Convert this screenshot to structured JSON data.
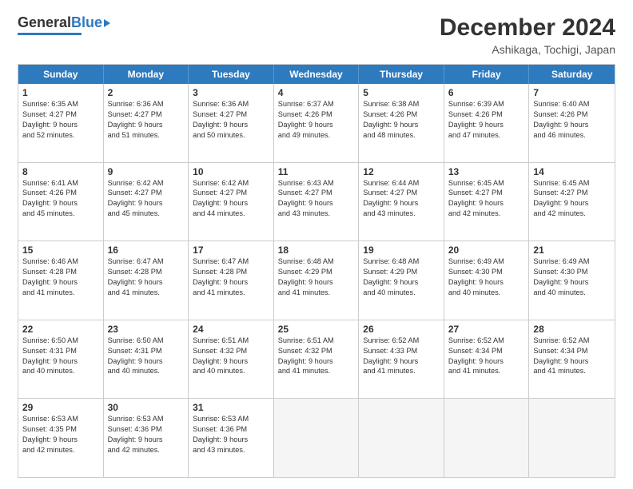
{
  "header": {
    "logo_general": "General",
    "logo_blue": "Blue",
    "month_year": "December 2024",
    "location": "Ashikaga, Tochigi, Japan"
  },
  "calendar": {
    "days_of_week": [
      "Sunday",
      "Monday",
      "Tuesday",
      "Wednesday",
      "Thursday",
      "Friday",
      "Saturday"
    ],
    "weeks": [
      [
        {
          "day": "1",
          "info": "Sunrise: 6:35 AM\nSunset: 4:27 PM\nDaylight: 9 hours\nand 52 minutes."
        },
        {
          "day": "2",
          "info": "Sunrise: 6:36 AM\nSunset: 4:27 PM\nDaylight: 9 hours\nand 51 minutes."
        },
        {
          "day": "3",
          "info": "Sunrise: 6:36 AM\nSunset: 4:27 PM\nDaylight: 9 hours\nand 50 minutes."
        },
        {
          "day": "4",
          "info": "Sunrise: 6:37 AM\nSunset: 4:26 PM\nDaylight: 9 hours\nand 49 minutes."
        },
        {
          "day": "5",
          "info": "Sunrise: 6:38 AM\nSunset: 4:26 PM\nDaylight: 9 hours\nand 48 minutes."
        },
        {
          "day": "6",
          "info": "Sunrise: 6:39 AM\nSunset: 4:26 PM\nDaylight: 9 hours\nand 47 minutes."
        },
        {
          "day": "7",
          "info": "Sunrise: 6:40 AM\nSunset: 4:26 PM\nDaylight: 9 hours\nand 46 minutes."
        }
      ],
      [
        {
          "day": "8",
          "info": "Sunrise: 6:41 AM\nSunset: 4:26 PM\nDaylight: 9 hours\nand 45 minutes."
        },
        {
          "day": "9",
          "info": "Sunrise: 6:42 AM\nSunset: 4:27 PM\nDaylight: 9 hours\nand 45 minutes."
        },
        {
          "day": "10",
          "info": "Sunrise: 6:42 AM\nSunset: 4:27 PM\nDaylight: 9 hours\nand 44 minutes."
        },
        {
          "day": "11",
          "info": "Sunrise: 6:43 AM\nSunset: 4:27 PM\nDaylight: 9 hours\nand 43 minutes."
        },
        {
          "day": "12",
          "info": "Sunrise: 6:44 AM\nSunset: 4:27 PM\nDaylight: 9 hours\nand 43 minutes."
        },
        {
          "day": "13",
          "info": "Sunrise: 6:45 AM\nSunset: 4:27 PM\nDaylight: 9 hours\nand 42 minutes."
        },
        {
          "day": "14",
          "info": "Sunrise: 6:45 AM\nSunset: 4:27 PM\nDaylight: 9 hours\nand 42 minutes."
        }
      ],
      [
        {
          "day": "15",
          "info": "Sunrise: 6:46 AM\nSunset: 4:28 PM\nDaylight: 9 hours\nand 41 minutes."
        },
        {
          "day": "16",
          "info": "Sunrise: 6:47 AM\nSunset: 4:28 PM\nDaylight: 9 hours\nand 41 minutes."
        },
        {
          "day": "17",
          "info": "Sunrise: 6:47 AM\nSunset: 4:28 PM\nDaylight: 9 hours\nand 41 minutes."
        },
        {
          "day": "18",
          "info": "Sunrise: 6:48 AM\nSunset: 4:29 PM\nDaylight: 9 hours\nand 41 minutes."
        },
        {
          "day": "19",
          "info": "Sunrise: 6:48 AM\nSunset: 4:29 PM\nDaylight: 9 hours\nand 40 minutes."
        },
        {
          "day": "20",
          "info": "Sunrise: 6:49 AM\nSunset: 4:30 PM\nDaylight: 9 hours\nand 40 minutes."
        },
        {
          "day": "21",
          "info": "Sunrise: 6:49 AM\nSunset: 4:30 PM\nDaylight: 9 hours\nand 40 minutes."
        }
      ],
      [
        {
          "day": "22",
          "info": "Sunrise: 6:50 AM\nSunset: 4:31 PM\nDaylight: 9 hours\nand 40 minutes."
        },
        {
          "day": "23",
          "info": "Sunrise: 6:50 AM\nSunset: 4:31 PM\nDaylight: 9 hours\nand 40 minutes."
        },
        {
          "day": "24",
          "info": "Sunrise: 6:51 AM\nSunset: 4:32 PM\nDaylight: 9 hours\nand 40 minutes."
        },
        {
          "day": "25",
          "info": "Sunrise: 6:51 AM\nSunset: 4:32 PM\nDaylight: 9 hours\nand 41 minutes."
        },
        {
          "day": "26",
          "info": "Sunrise: 6:52 AM\nSunset: 4:33 PM\nDaylight: 9 hours\nand 41 minutes."
        },
        {
          "day": "27",
          "info": "Sunrise: 6:52 AM\nSunset: 4:34 PM\nDaylight: 9 hours\nand 41 minutes."
        },
        {
          "day": "28",
          "info": "Sunrise: 6:52 AM\nSunset: 4:34 PM\nDaylight: 9 hours\nand 41 minutes."
        }
      ],
      [
        {
          "day": "29",
          "info": "Sunrise: 6:53 AM\nSunset: 4:35 PM\nDaylight: 9 hours\nand 42 minutes."
        },
        {
          "day": "30",
          "info": "Sunrise: 6:53 AM\nSunset: 4:36 PM\nDaylight: 9 hours\nand 42 minutes."
        },
        {
          "day": "31",
          "info": "Sunrise: 6:53 AM\nSunset: 4:36 PM\nDaylight: 9 hours\nand 43 minutes."
        },
        {
          "day": "",
          "info": ""
        },
        {
          "day": "",
          "info": ""
        },
        {
          "day": "",
          "info": ""
        },
        {
          "day": "",
          "info": ""
        }
      ]
    ]
  }
}
